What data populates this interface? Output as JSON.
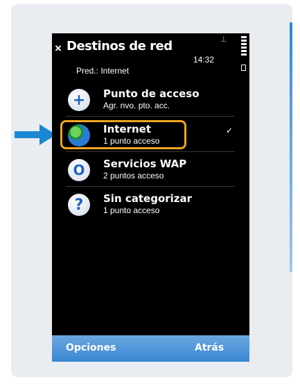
{
  "statusbar": {
    "time": "14:32"
  },
  "header": {
    "close_glyph": "×",
    "title": "Destinos de red",
    "subtitle": "Pred.: Internet"
  },
  "items": [
    {
      "label": "Punto de acceso",
      "sub": "Agr. nvo. pto. acc.",
      "icon": "plus-icon",
      "glyph": "+"
    },
    {
      "label": "Internet",
      "sub": "1 punto acceso",
      "icon": "globe-icon",
      "selected": true
    },
    {
      "label": "Servicios WAP",
      "sub": "2 puntos acceso",
      "icon": "wap-icon",
      "glyph": "O"
    },
    {
      "label": "Sin categorizar",
      "sub": "1 punto acceso",
      "icon": "question-icon",
      "glyph": "?"
    }
  ],
  "selected_check": "✓",
  "softkeys": {
    "left": "Opciones",
    "right": "Atrás"
  },
  "colors": {
    "highlight": "#f2a51f",
    "softkey_bar": "#4a93d8",
    "arrow": "#1a87d4"
  }
}
